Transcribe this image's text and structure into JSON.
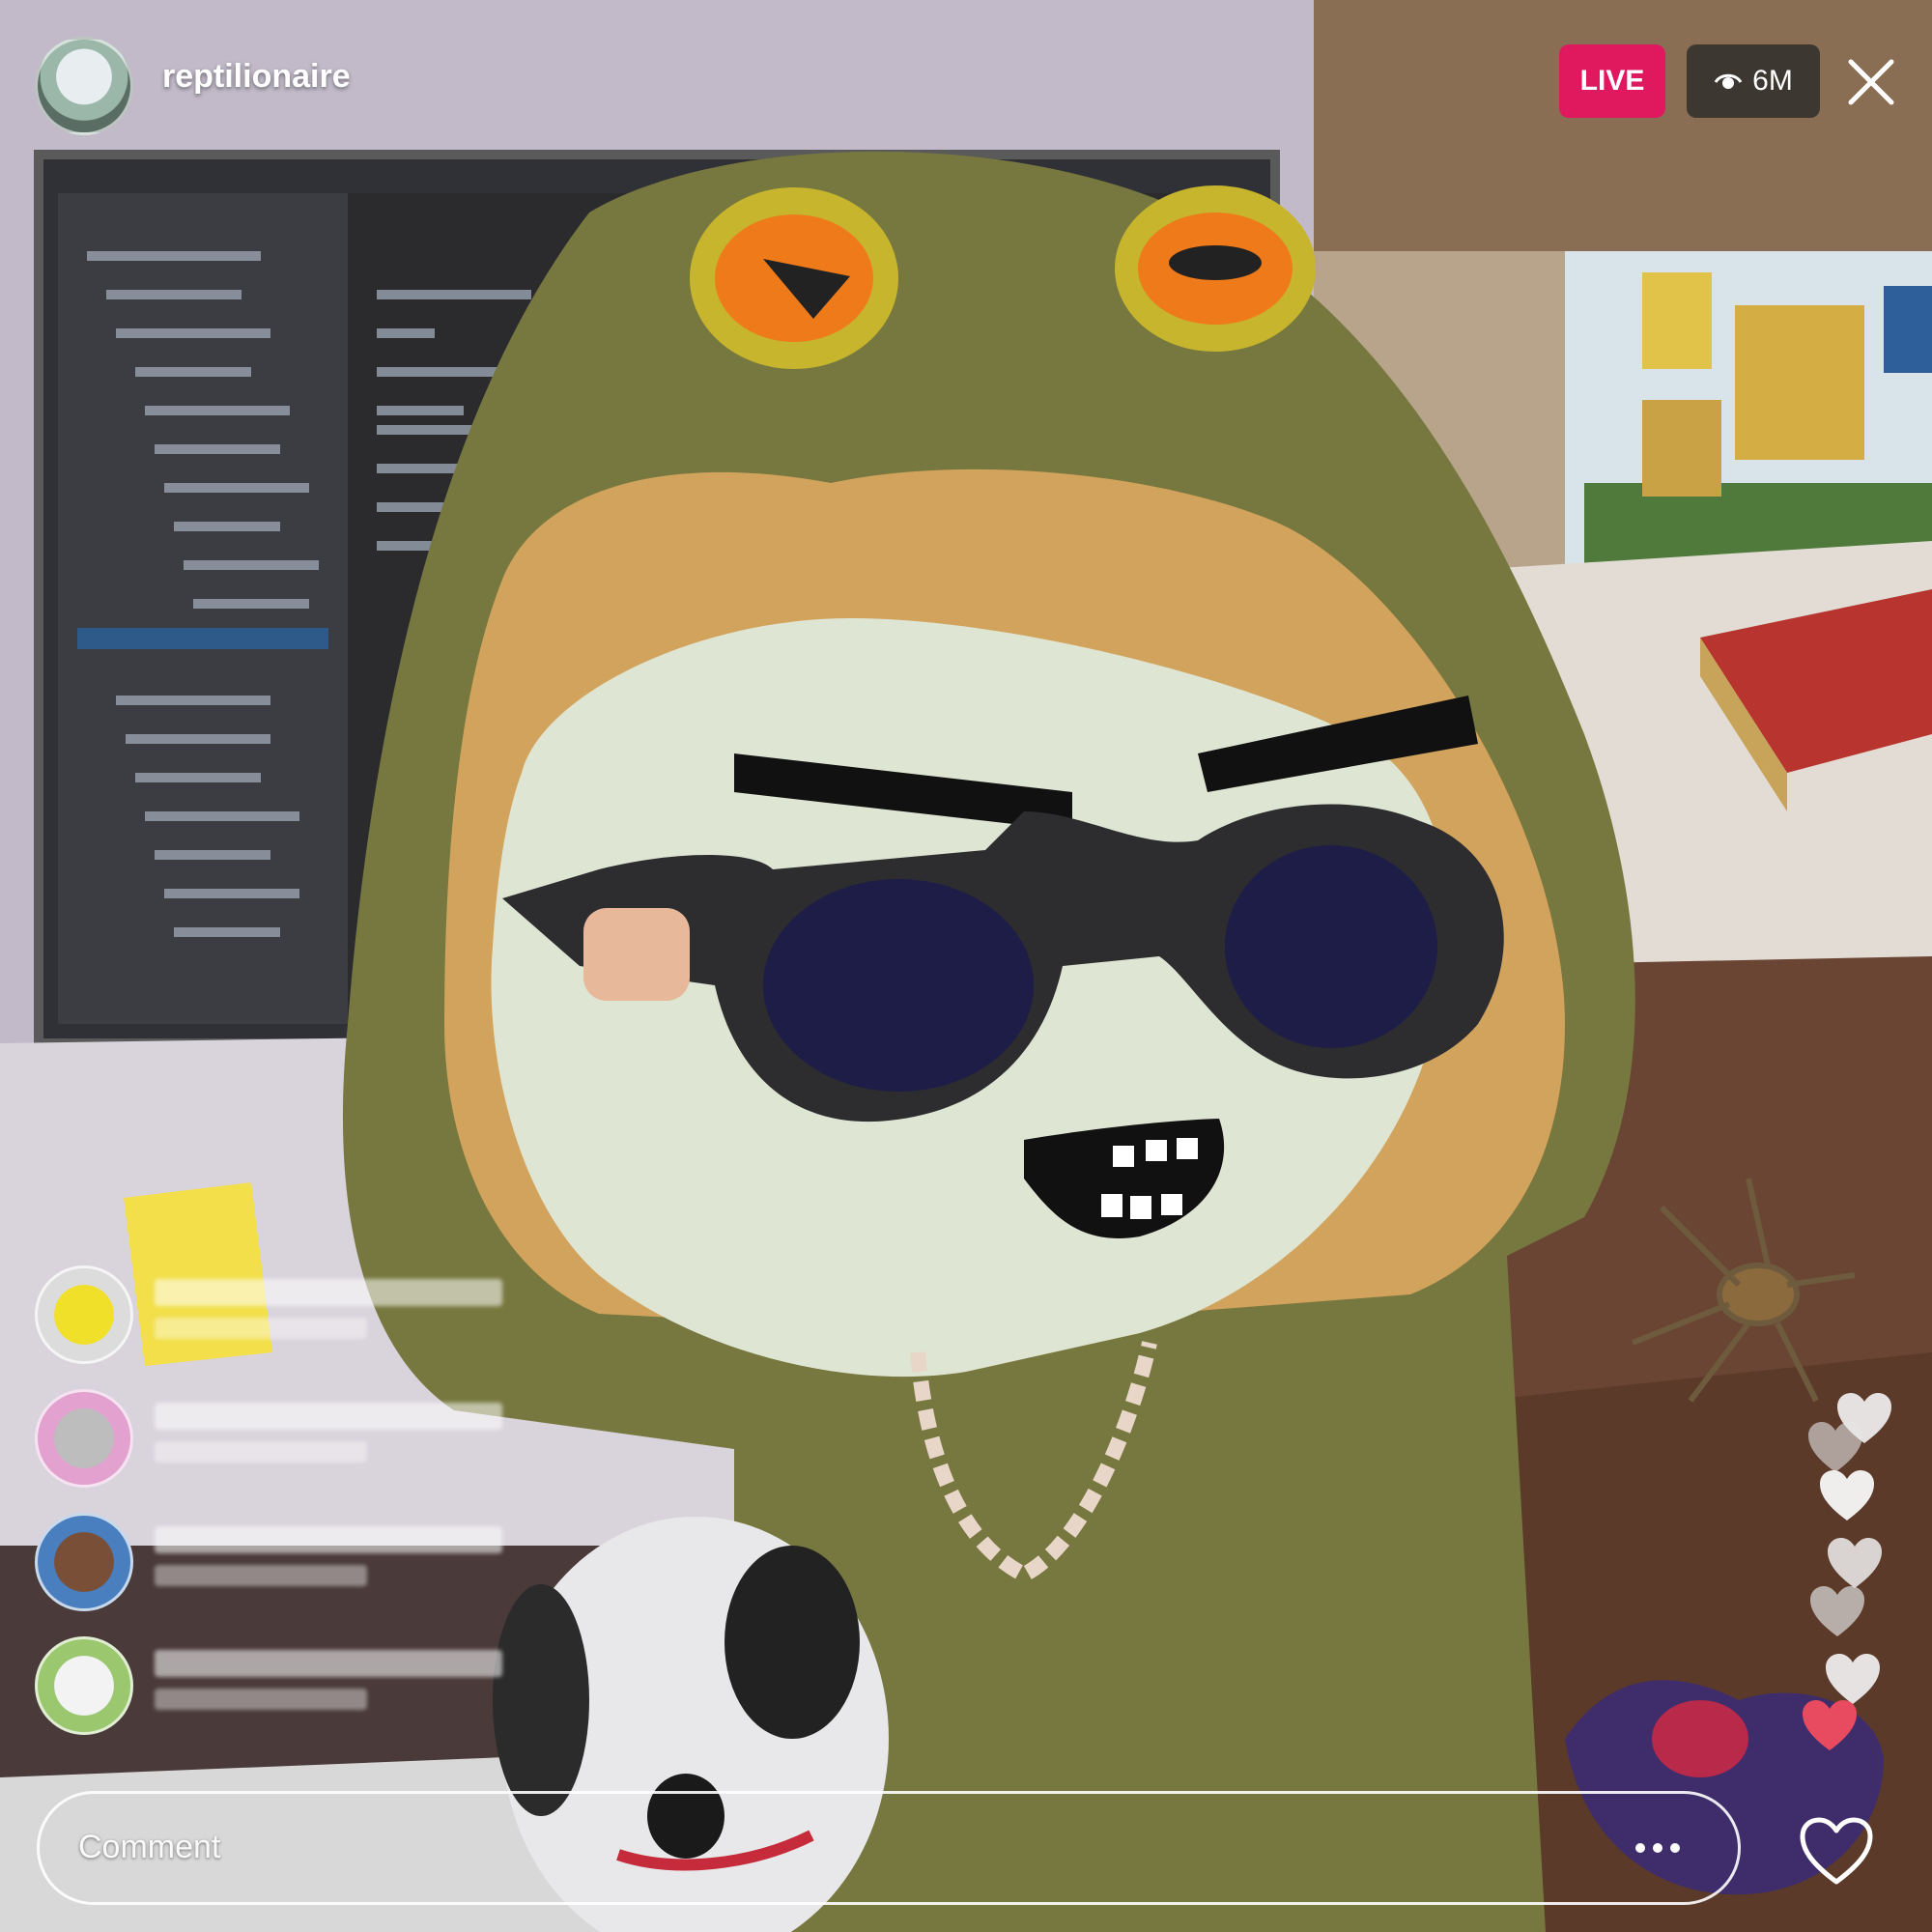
{
  "header": {
    "username": "reptilionaire",
    "live_label": "LIVE",
    "viewer_count": "6M"
  },
  "comment_input": {
    "placeholder": "Comment"
  },
  "icons": {
    "close": "close-icon",
    "eye": "eye-icon",
    "more": "more-options-icon",
    "heart": "heart-icon"
  },
  "colors": {
    "live_badge": "#e0195f",
    "viewer_pill": "#282828",
    "heart_red": "#e84a5f"
  }
}
